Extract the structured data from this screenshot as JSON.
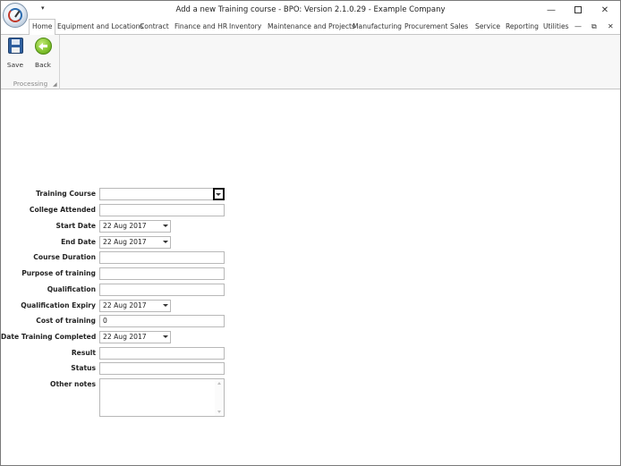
{
  "window": {
    "title": "Add a new Training course - BPO: Version 2.1.0.29 - Example Company",
    "minimize_glyph": "—",
    "close_glyph": "✕"
  },
  "qat": {
    "glyph": "▾"
  },
  "tabs": [
    {
      "label": "Home",
      "active": true
    },
    {
      "label": "Equipment and Locations"
    },
    {
      "label": "Contract"
    },
    {
      "label": "Finance and HR"
    },
    {
      "label": "Inventory"
    },
    {
      "label": "Maintenance and Projects"
    },
    {
      "label": "Manufacturing"
    },
    {
      "label": "Procurement"
    },
    {
      "label": "Sales"
    },
    {
      "label": "Service"
    },
    {
      "label": "Reporting"
    },
    {
      "label": "Utilities"
    }
  ],
  "tab_controls": {
    "minimize": "—",
    "restore": "⧉",
    "close": "✕"
  },
  "ribbon": {
    "group_label": "Processing",
    "launcher_glyph": "◢",
    "save_label": "Save",
    "back_label": "Back"
  },
  "form": {
    "training_course": {
      "label": "Training Course",
      "value": ""
    },
    "college_attended": {
      "label": "College Attended",
      "value": ""
    },
    "start_date": {
      "label": "Start Date",
      "value": "22 Aug 2017"
    },
    "end_date": {
      "label": "End Date",
      "value": "22 Aug 2017"
    },
    "course_duration": {
      "label": "Course Duration",
      "value": ""
    },
    "purpose": {
      "label": "Purpose of training",
      "value": ""
    },
    "qualification": {
      "label": "Qualification",
      "value": ""
    },
    "qualification_expiry": {
      "label": "Qualification Expiry",
      "value": "22 Aug 2017"
    },
    "cost": {
      "label": "Cost of training",
      "value": "0"
    },
    "date_completed": {
      "label": "Date Training Completed",
      "value": "22 Aug 2017"
    },
    "result": {
      "label": "Result",
      "value": ""
    },
    "status": {
      "label": "Status",
      "value": ""
    },
    "other_notes": {
      "label": "Other notes",
      "value": ""
    }
  }
}
